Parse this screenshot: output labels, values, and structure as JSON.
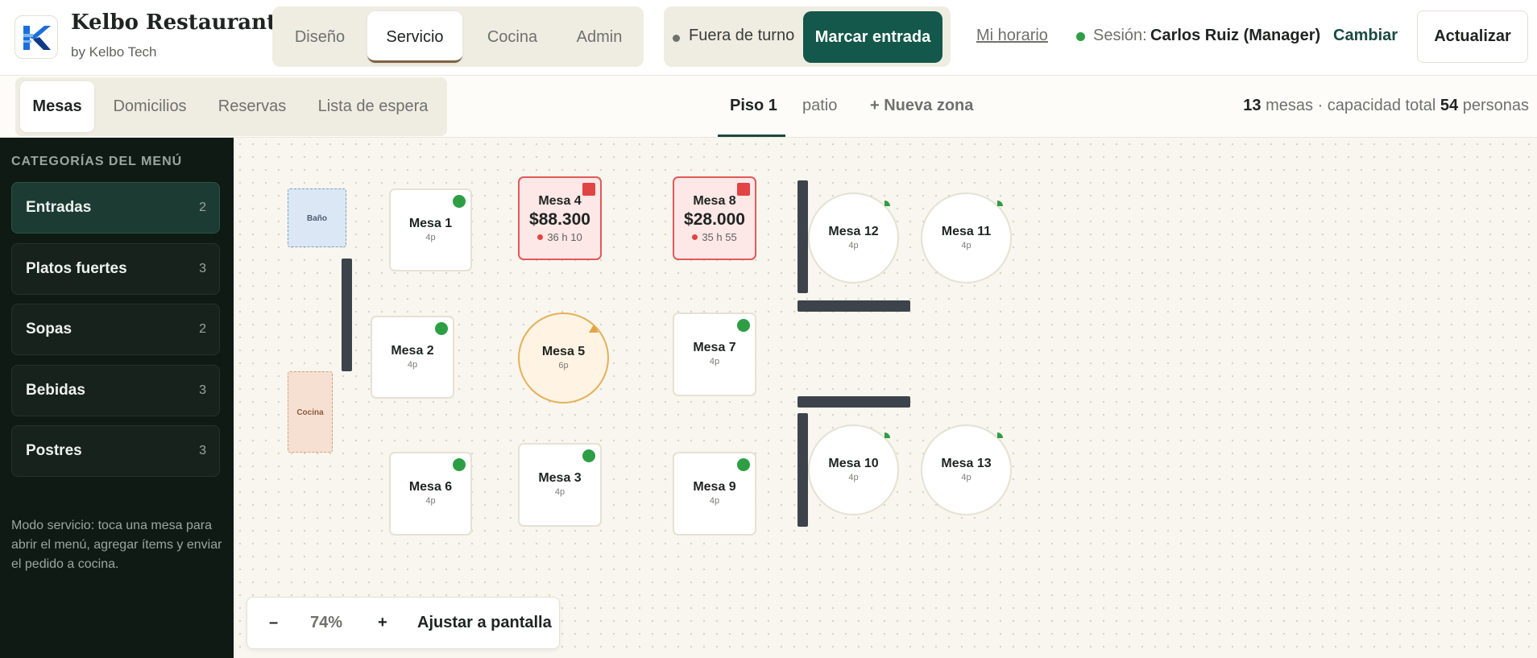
{
  "header": {
    "brand_name": "Kelbo Restaurants",
    "brand_sub": "by Kelbo Tech",
    "mode_tabs": [
      {
        "label": "Diseño"
      },
      {
        "label": "Servicio"
      },
      {
        "label": "Cocina"
      },
      {
        "label": "Admin"
      }
    ],
    "shift_status": "Fuera de turno",
    "clock_in": "Marcar entrada",
    "schedule_link": "Mi horario",
    "session_label": "Sesión:",
    "session_user": "Carlos Ruiz (Manager)",
    "change_link": "Cambiar",
    "refresh": "Actualizar",
    "colors": {
      "primary": "#13584a",
      "online": "#2e9e45"
    }
  },
  "subbar": {
    "view_tabs": [
      {
        "label": "Mesas"
      },
      {
        "label": "Domicilios"
      },
      {
        "label": "Reservas"
      },
      {
        "label": "Lista de espera"
      }
    ],
    "zones": [
      {
        "label": "Piso 1"
      },
      {
        "label": "patio"
      },
      {
        "label": "+ Nueva zona"
      }
    ],
    "capacity": {
      "tables": "13",
      "tables_text": "mesas · capacidad total",
      "people": "54",
      "people_text": "personas"
    }
  },
  "sidebar": {
    "title": "CATEGORÍAS DEL MENÚ",
    "categories": [
      {
        "name": "Entradas",
        "count": "2"
      },
      {
        "name": "Platos fuertes",
        "count": "3"
      },
      {
        "name": "Sopas",
        "count": "2"
      },
      {
        "name": "Bebidas",
        "count": "3"
      },
      {
        "name": "Postres",
        "count": "3"
      }
    ],
    "help": "Modo servicio: toca una mesa para abrir el menú, agregar ítems y enviar el pedido a cocina."
  },
  "floor": {
    "fixtures": {
      "bano": "Baño",
      "cocina": "Cocina"
    },
    "tables": {
      "t1": {
        "name": "Mesa 1",
        "cap": "4p"
      },
      "t2": {
        "name": "Mesa 2",
        "cap": "4p"
      },
      "t3": {
        "name": "Mesa 3",
        "cap": "4p"
      },
      "t4": {
        "name": "Mesa 4",
        "total": "$88.300",
        "time": "36 h 10"
      },
      "t5": {
        "name": "Mesa 5",
        "cap": "6p"
      },
      "t6": {
        "name": "Mesa 6",
        "cap": "4p"
      },
      "t7": {
        "name": "Mesa 7",
        "cap": "4p"
      },
      "t8": {
        "name": "Mesa 8",
        "total": "$28.000",
        "time": "35 h 55"
      },
      "t9": {
        "name": "Mesa 9",
        "cap": "4p"
      },
      "t10": {
        "name": "Mesa 10",
        "cap": "4p"
      },
      "t11": {
        "name": "Mesa 11",
        "cap": "4p"
      },
      "t12": {
        "name": "Mesa 12",
        "cap": "4p"
      },
      "t13": {
        "name": "Mesa 13",
        "cap": "4p"
      }
    },
    "status_colors": {
      "free": "#2e9e45",
      "occupied": "#e04444",
      "reserved": "#e3a444"
    }
  },
  "zoom": {
    "minus": "–",
    "level": "74%",
    "plus": "+",
    "fit": "Ajustar a pantalla"
  }
}
